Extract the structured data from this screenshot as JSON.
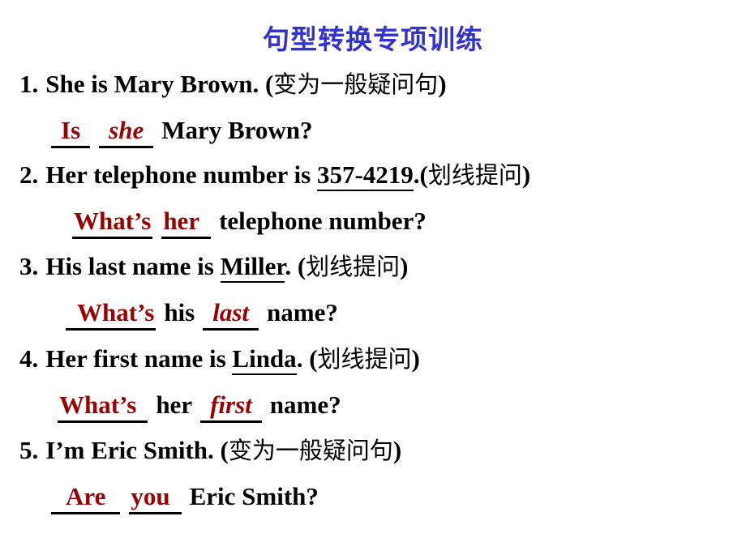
{
  "slide": {
    "title": "句型转换专项训练",
    "title_color": "#3333cc",
    "answer_color": "#990000",
    "background": "#ffffff"
  },
  "items": [
    {
      "number": "1.",
      "stem_before": "She is Mary Brown. ",
      "target": "",
      "stem_after": "",
      "instruction_open": "(",
      "instruction": "变为一般疑问句",
      "instruction_close": ")",
      "answer_parts": [
        {
          "text": "Is",
          "type": "blank",
          "italic": false
        },
        {
          "text": "she",
          "type": "blank",
          "italic": true
        },
        {
          "text": "Mary Brown?",
          "type": "plain",
          "italic": false
        }
      ]
    },
    {
      "number": "2.",
      "stem_before": "Her telephone number is ",
      "target": "357-4219",
      "stem_after": ".",
      "instruction_open": "(",
      "instruction": "划线提问",
      "instruction_close": ")",
      "answer_parts": [
        {
          "text": "What’s",
          "type": "blank",
          "italic": false
        },
        {
          "text": "her",
          "type": "blank",
          "italic": false
        },
        {
          "text": "telephone number?",
          "type": "plain",
          "italic": false
        }
      ]
    },
    {
      "number": "3.",
      "stem_before": "His last name is ",
      "target": "Miller",
      "stem_after": ". ",
      "instruction_open": "(",
      "instruction": "划线提问",
      "instruction_close": ")",
      "answer_parts": [
        {
          "text": "What’s",
          "type": "blank",
          "italic": false
        },
        {
          "text": "his",
          "type": "plain",
          "italic": false
        },
        {
          "text": "last",
          "type": "blank",
          "italic": true
        },
        {
          "text": "name?",
          "type": "plain",
          "italic": false
        }
      ]
    },
    {
      "number": "4.",
      "stem_before": "Her first name is ",
      "target": "Linda",
      "stem_after": ". ",
      "instruction_open": "(",
      "instruction": "划线提问",
      "instruction_close": ")",
      "answer_parts": [
        {
          "text": "What’s",
          "type": "blank",
          "italic": false
        },
        {
          "text": "her",
          "type": "plain",
          "italic": false
        },
        {
          "text": "first",
          "type": "blank",
          "italic": true
        },
        {
          "text": "name?",
          "type": "plain",
          "italic": false
        }
      ]
    },
    {
      "number": "5.",
      "stem_before": "I’m Eric Smith. ",
      "target": "",
      "stem_after": "",
      "instruction_open": "(",
      "instruction": "变为一般疑问句",
      "instruction_close": ")",
      "answer_parts": [
        {
          "text": "Are",
          "type": "blank",
          "italic": false
        },
        {
          "text": "you",
          "type": "blank",
          "italic": false
        },
        {
          "text": "Eric Smith?",
          "type": "plain",
          "italic": false
        }
      ]
    }
  ]
}
